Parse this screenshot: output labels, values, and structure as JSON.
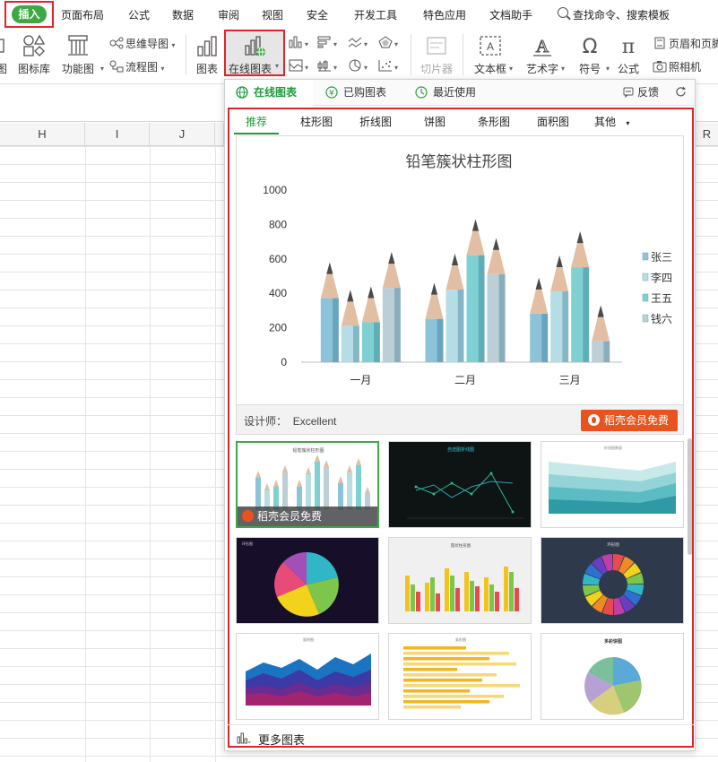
{
  "menu": {
    "insert": "插入",
    "items": [
      "页面布局",
      "公式",
      "数据",
      "审阅",
      "视图",
      "安全",
      "开发工具",
      "特色应用",
      "文档助手"
    ],
    "search": "查找命令、搜索模板"
  },
  "ribbon": {
    "left_cut": "图",
    "icon_library": "图标库",
    "function_chart": "功能图",
    "mind_map": "思维导图",
    "flowchart": "流程图",
    "chart": "图表",
    "online_chart": "在线图表",
    "slicer": "切片器",
    "textbox": "文本框",
    "wordart": "艺术字",
    "symbol": "符号",
    "formula": "公式",
    "header_footer": "页眉和页脚",
    "camera": "照相机"
  },
  "columns": [
    "H",
    "I",
    "J",
    "R"
  ],
  "panel": {
    "tabs": {
      "online": "在线图表",
      "purchased": "已购图表",
      "recent": "最近使用",
      "feedback": "反馈"
    },
    "subtabs": [
      "推荐",
      "柱形图",
      "折线图",
      "饼图",
      "条形图",
      "面积图",
      "其他"
    ],
    "designer_label": "设计师：",
    "designer_name": "Excellent",
    "vip_label": "稻壳会员免费",
    "more_charts": "更多图表",
    "thumb_vip": "稻壳会员免费"
  },
  "chart_data": {
    "type": "bar",
    "title": "铅笔簇状柱形图",
    "categories": [
      "一月",
      "二月",
      "三月"
    ],
    "ylim": [
      0,
      1000
    ],
    "yticks": [
      0,
      200,
      400,
      600,
      800,
      1000
    ],
    "series": [
      {
        "name": "张三",
        "values": [
          580,
          460,
          490
        ],
        "color": "#8dc3d9"
      },
      {
        "name": "李四",
        "values": [
          420,
          630,
          620
        ],
        "color": "#b5dde6"
      },
      {
        "name": "王五",
        "values": [
          440,
          830,
          760
        ],
        "color": "#7fd0d3"
      },
      {
        "name": "钱六",
        "values": [
          640,
          720,
          330
        ],
        "color": "#bccfd6"
      }
    ],
    "legend": "right"
  },
  "thumbs": {
    "t1_title": "铅笔簇状柱形图",
    "t2_title": "自选图折线图",
    "t3_title": "折线图数量",
    "t4_title": "环形图",
    "t5_title": "簇状柱形图",
    "t6_title": "环形图",
    "t7_title": "面积图",
    "t8_title": "条形图",
    "t9_title": "多彩饼图"
  }
}
